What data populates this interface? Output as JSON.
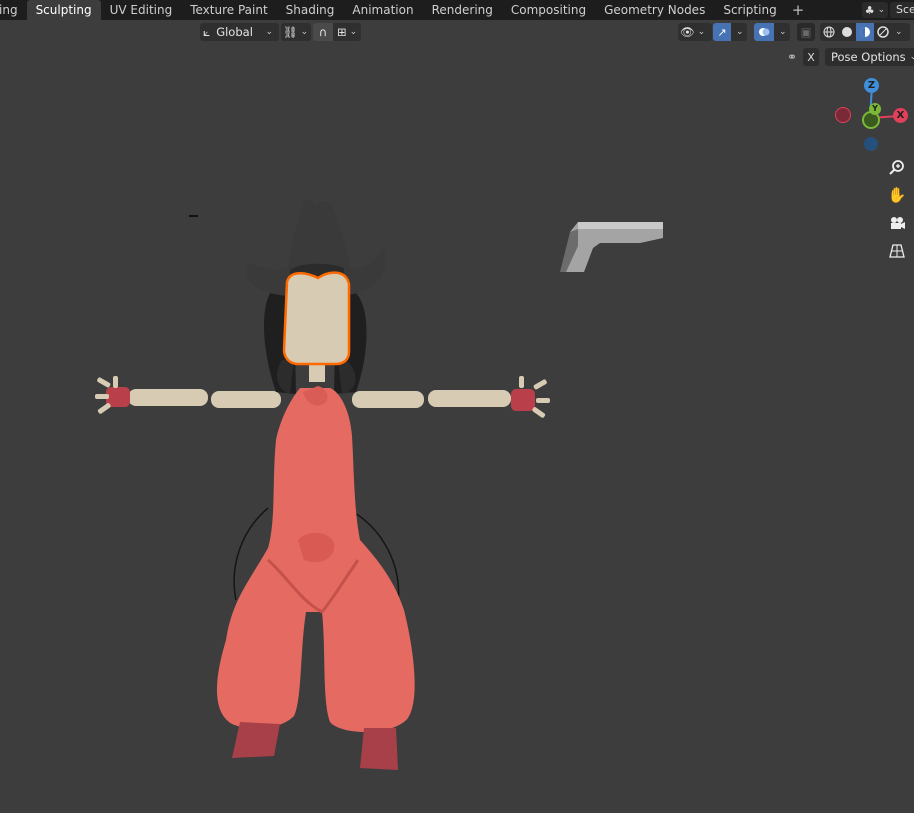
{
  "workspaces": {
    "tabs": [
      "ing",
      "Sculpting",
      "UV Editing",
      "Texture Paint",
      "Shading",
      "Animation",
      "Rendering",
      "Compositing",
      "Geometry Nodes",
      "Scripting"
    ],
    "active_index": 1,
    "add_label": "+",
    "scene_label": "Sce"
  },
  "header": {
    "orientation_label": "Global",
    "pose_options_label": "Pose Options",
    "mirror_x_label": "X"
  },
  "nav_gizmo": {
    "z_label": "Z",
    "x_label": "X",
    "y_label": "Y",
    "x_color": "#e0405a",
    "y_color": "#7ab836",
    "z_color": "#3f8fdb"
  },
  "icons": {
    "zoom": "magnifier-plus-icon",
    "pan": "hand-icon",
    "camera": "camera-icon",
    "perspective": "grid-perspective-icon"
  },
  "colors": {
    "viewport_bg": "#3d3d3d",
    "selection_outline": "#ff6a00",
    "body_color": "#e56a62",
    "skin_color": "#d8cbb4",
    "hat_color": "#3a3a3a"
  }
}
